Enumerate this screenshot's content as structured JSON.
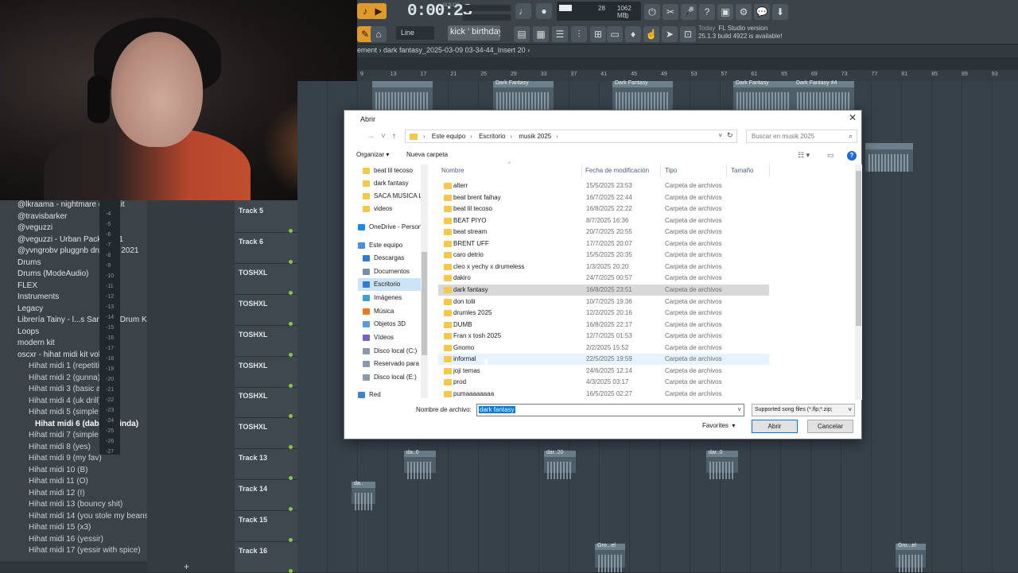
{
  "fl": {
    "time": "0:00:23",
    "time_unit": "M:S:CS",
    "cpu": "28",
    "ram": "1062 MB",
    "voices": "0",
    "snap_mode": "Line",
    "hint_text": "kick ' birthday '",
    "news_day": "Today",
    "news_line1": "FL Studio version",
    "news_line2": "25.1.3 build 4922 is available!",
    "playlist_breadcrumb": "ement › dark fantasy_2025-03-09 03-34-44_Insert 20 ›",
    "timeline_marks": [
      "9",
      "13",
      "17",
      "21",
      "25",
      "29",
      "33",
      "37",
      "41",
      "45",
      "49",
      "53",
      "57",
      "61",
      "65",
      "69",
      "73",
      "77",
      "81",
      "85",
      "89",
      "93"
    ],
    "clip_labels": [
      "Dark Fantasy",
      "Dark Fantasy",
      "Dark Fantasy",
      "Dark Fantasy #4"
    ],
    "lower_clip_labels": [
      "da..0",
      "dar..20",
      "dar..0",
      "da..",
      "Gro...el",
      "Gro...el"
    ]
  },
  "browser": {
    "items": [
      {
        "label": "@lkraama - nightmare drumkit",
        "kind": "folder"
      },
      {
        "label": "@travisbarker",
        "kind": "folder"
      },
      {
        "label": "@veguzzi",
        "kind": "folder"
      },
      {
        "label": "@veguzzi - Urban Pack Vol. 1",
        "kind": "folder"
      },
      {
        "label": "@yvngrobv pluggnb drum kit 2021",
        "kind": "folder"
      },
      {
        "label": "Drums",
        "kind": "folder"
      },
      {
        "label": "Drums (ModeAudio)",
        "kind": "folder"
      },
      {
        "label": "FLEX",
        "kind": "folder"
      },
      {
        "label": "Instruments",
        "kind": "folder"
      },
      {
        "label": "Legacy",
        "kind": "folder"
      },
      {
        "label": "Librería Tainy - l...s Samples Drum Kit",
        "kind": "folder"
      },
      {
        "label": "Loops",
        "kind": "folder"
      },
      {
        "label": "modern kit",
        "kind": "folder"
      },
      {
        "label": "oscxr - hihat midi kit vol.2",
        "kind": "folder"
      },
      {
        "label": "Hihat midi 1 (repetitive)",
        "kind": "sub"
      },
      {
        "label": "Hihat midi 2 (gunna)",
        "kind": "sub"
      },
      {
        "label": "Hihat midi 3 (basic af)",
        "kind": "sub"
      },
      {
        "label": "Hihat midi 4 (uk drill)",
        "kind": "sub"
      },
      {
        "label": "Hihat midi 5 (simple 1)",
        "kind": "sub"
      },
      {
        "label": "Hihat midi 6 (dababy kinda)",
        "kind": "selected"
      },
      {
        "label": "Hihat midi 7 (simple 2)",
        "kind": "sub"
      },
      {
        "label": "Hihat midi 8 (yes)",
        "kind": "sub"
      },
      {
        "label": "Hihat midi 9 (my fav)",
        "kind": "sub"
      },
      {
        "label": "Hihat midi 10 (B)",
        "kind": "sub"
      },
      {
        "label": "Hihat midi 11 (O)",
        "kind": "sub"
      },
      {
        "label": "Hihat midi 12 (I)",
        "kind": "sub"
      },
      {
        "label": "Hihat midi 13 (bouncy shit)",
        "kind": "sub"
      },
      {
        "label": "Hihat midi 14 (you stole my beans)",
        "kind": "sub"
      },
      {
        "label": "Hihat midi 15 (x3)",
        "kind": "sub"
      },
      {
        "label": "Hihat midi 16 (yessir)",
        "kind": "sub"
      },
      {
        "label": "Hihat midi 17 (yessir with spice)",
        "kind": "sub"
      }
    ],
    "meter_labels": [
      "-4",
      "-5",
      "-6",
      "-7",
      "-8",
      "-9",
      "-10",
      "-11",
      "-12",
      "-13",
      "-14",
      "-15",
      "-16",
      "-17",
      "-18",
      "-19",
      "-20",
      "-21",
      "-22",
      "-23",
      "-24",
      "-25",
      "-26",
      "-27"
    ]
  },
  "tracks": [
    "Track 5",
    "Track 6",
    "TOSHXL",
    "TOSHXL",
    "TOSHXL",
    "TOSHXL",
    "TOSHXL",
    "TOSHXL",
    "Track 13",
    "Track 14",
    "Track 15",
    "Track 16"
  ],
  "dialog": {
    "title": "Abrir",
    "path": [
      "Este equipo",
      "Escritorio",
      "musik 2025"
    ],
    "search_placeholder": "Buscar en musik 2025",
    "organize": "Organizar",
    "new_folder": "Nueva carpeta",
    "columns": {
      "name": "Nombre",
      "date": "Fecha de modificación",
      "type": "Tipo",
      "size": "Tamaño"
    },
    "nav": [
      {
        "label": "beat lil tecoso",
        "icon": "folder"
      },
      {
        "label": "dark fantasy",
        "icon": "folder"
      },
      {
        "label": "SACA MUSICA L",
        "icon": "folder"
      },
      {
        "label": "videos",
        "icon": "folder"
      },
      {
        "label": "OneDrive - Person",
        "icon": "cloud"
      },
      {
        "label": "Este equipo",
        "icon": "pc"
      },
      {
        "label": "Descargas",
        "icon": "download"
      },
      {
        "label": "Documentos",
        "icon": "docs"
      },
      {
        "label": "Escritorio",
        "icon": "desktop"
      },
      {
        "label": "Imágenes",
        "icon": "images"
      },
      {
        "label": "Música",
        "icon": "music"
      },
      {
        "label": "Objetos 3D",
        "icon": "3d"
      },
      {
        "label": "Vídeos",
        "icon": "video"
      },
      {
        "label": "Disco local (C:)",
        "icon": "disk"
      },
      {
        "label": "Reservado para e",
        "icon": "disk"
      },
      {
        "label": "Disco local (E:)",
        "icon": "disk"
      },
      {
        "label": "Red",
        "icon": "network"
      }
    ],
    "files": [
      {
        "name": "alterr",
        "date": "15/5/2025 23:53",
        "type": "Carpeta de archivos"
      },
      {
        "name": "beat brent faihay",
        "date": "16/7/2025 22:44",
        "type": "Carpeta de archivos"
      },
      {
        "name": "beat lil tecoso",
        "date": "16/8/2025 22:22",
        "type": "Carpeta de archivos"
      },
      {
        "name": "BEAT PIYO",
        "date": "8/7/2025 16:36",
        "type": "Carpeta de archivos"
      },
      {
        "name": "beat stream",
        "date": "20/7/2025 20:55",
        "type": "Carpeta de archivos"
      },
      {
        "name": "BRENT UFF",
        "date": "17/7/2025 20:07",
        "type": "Carpeta de archivos"
      },
      {
        "name": "caro detrio",
        "date": "15/5/2025 20:35",
        "type": "Carpeta de archivos"
      },
      {
        "name": "cleo x yechy x drumeless",
        "date": "1/3/2025 20:20",
        "type": "Carpeta de archivos"
      },
      {
        "name": "dakiro",
        "date": "24/7/2025 00:57",
        "type": "Carpeta de archivos"
      },
      {
        "name": "dark fantasy",
        "date": "16/8/2025 23:51",
        "type": "Carpeta de archivos"
      },
      {
        "name": "don tolii",
        "date": "10/7/2025 19:36",
        "type": "Carpeta de archivos"
      },
      {
        "name": "drumles 2025",
        "date": "12/2/2025 20:16",
        "type": "Carpeta de archivos"
      },
      {
        "name": "DUMB",
        "date": "16/8/2025 22:17",
        "type": "Carpeta de archivos"
      },
      {
        "name": "Fran x tosh 2025",
        "date": "12/7/2025 01:53",
        "type": "Carpeta de archivos"
      },
      {
        "name": "Gnomo",
        "date": "2/2/2025 15:52",
        "type": "Carpeta de archivos"
      },
      {
        "name": "informal",
        "date": "22/5/2025 19:59",
        "type": "Carpeta de archivos"
      },
      {
        "name": "joji temas",
        "date": "24/6/2025 12:14",
        "type": "Carpeta de archivos"
      },
      {
        "name": "prod",
        "date": "4/3/2025 03:17",
        "type": "Carpeta de archivos"
      },
      {
        "name": "pumaaaaaaaa",
        "date": "16/5/2025 02:27",
        "type": "Carpeta de archivos"
      }
    ],
    "filename_label": "Nombre de archivo:",
    "filename_value": "dark fantasy",
    "filetype": "Supported song files (*.flp;*.zip;",
    "favorites": "Favorites",
    "open_button": "Abrir",
    "cancel_button": "Cancelar"
  }
}
